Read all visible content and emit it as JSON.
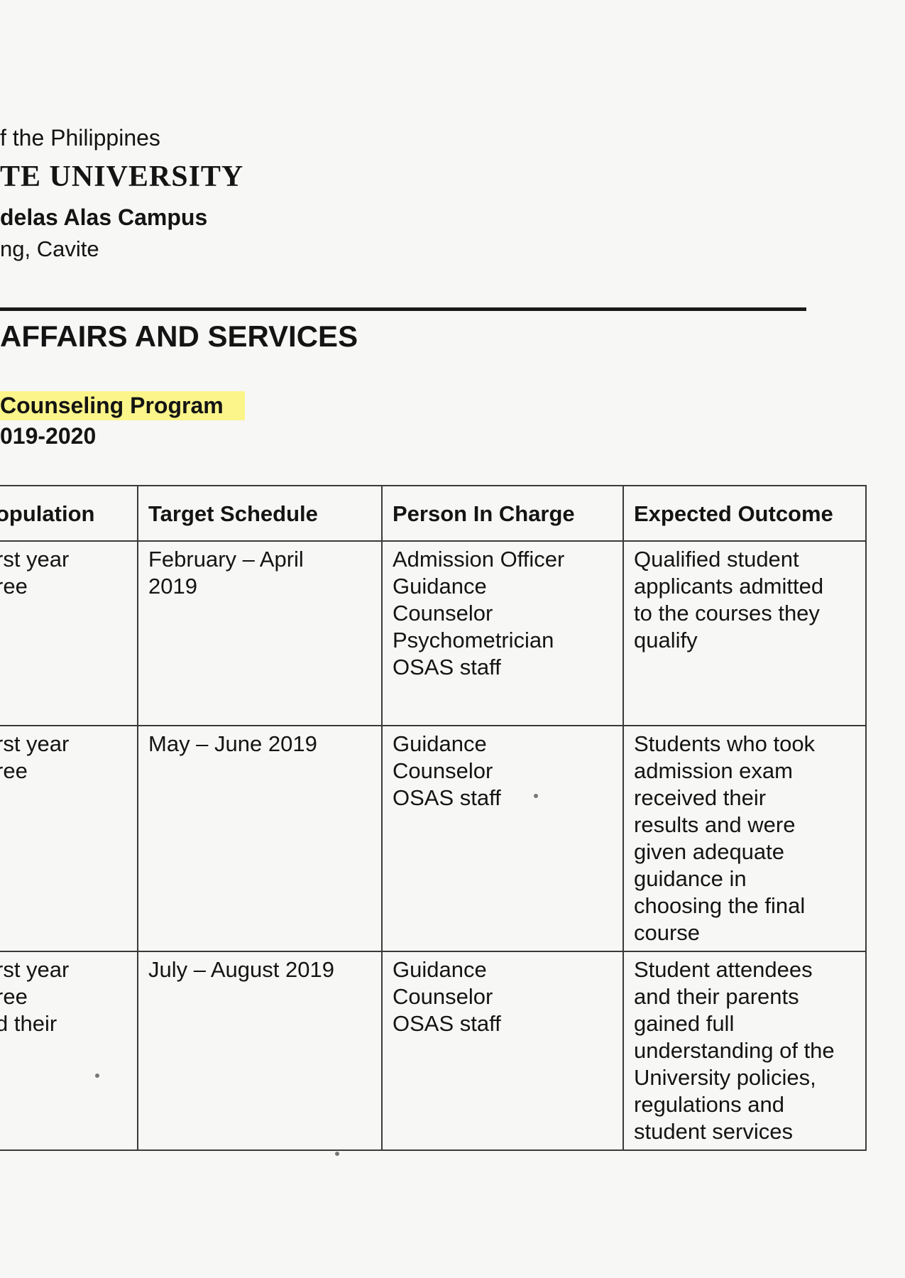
{
  "header": {
    "line1": "f the Philippines",
    "line2": "TE UNIVERSITY",
    "line3": "delas Alas Campus",
    "line4": "ng, Cavite"
  },
  "section_title": "AFFAIRS AND SERVICES",
  "program": {
    "title": "Counseling Program",
    "year": "019-2020"
  },
  "table": {
    "headers": [
      "opulation",
      "Target Schedule",
      "Person In Charge",
      "Expected Outcome"
    ],
    "rows": [
      {
        "population": "rst year\nree",
        "schedule": "February – April\n2019",
        "person": "Admission Officer\nGuidance\nCounselor\nPsychometrician\nOSAS staff",
        "outcome": "Qualified student\napplicants admitted\nto the courses they\nqualify"
      },
      {
        "population": "rst year\nree",
        "schedule": "May – June 2019",
        "person": "Guidance\nCounselor\nOSAS staff",
        "outcome": "Students who took\nadmission exam\nreceived their\nresults and were\ngiven adequate\nguidance in\nchoosing the final\ncourse"
      },
      {
        "population": "rst year\nree\nd their",
        "schedule": "July – August 2019",
        "person": "Guidance\nCounselor\nOSAS staff",
        "outcome": "Student attendees\nand their parents\ngained full\nunderstanding of the\nUniversity policies,\nregulations and\nstudent services"
      }
    ]
  }
}
